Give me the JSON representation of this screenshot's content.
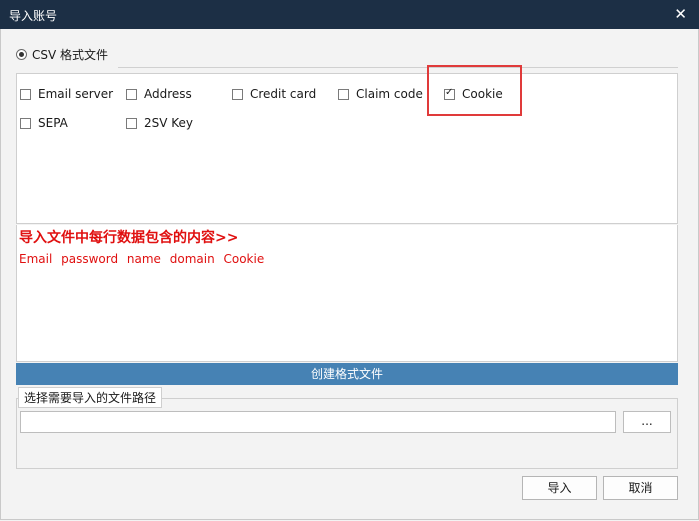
{
  "window": {
    "title": "导入账号",
    "close_symbol": "✕"
  },
  "format": {
    "radio_label": "CSV 格式文件",
    "selected": true
  },
  "options": [
    {
      "label": "Email server",
      "checked": false
    },
    {
      "label": "Address",
      "checked": false
    },
    {
      "label": "Credit card",
      "checked": false
    },
    {
      "label": "Claim code",
      "checked": false
    },
    {
      "label": "Cookie",
      "checked": true
    },
    {
      "label": "SEPA",
      "checked": false
    },
    {
      "label": "2SV Key",
      "checked": false
    }
  ],
  "description": {
    "title": "导入文件中每行数据包含的内容>>",
    "fields": "Email password name domain Cookie"
  },
  "create_button": "创建格式文件",
  "path": {
    "legend": "选择需要导入的文件路径",
    "value": "",
    "browse_label": "..."
  },
  "footer": {
    "import_label": "导入",
    "cancel_label": "取消"
  },
  "colors": {
    "titlebar": "#1c2f45",
    "accent": "#4682b4",
    "highlight": "#e03a3a",
    "description_text": "#e01010"
  }
}
